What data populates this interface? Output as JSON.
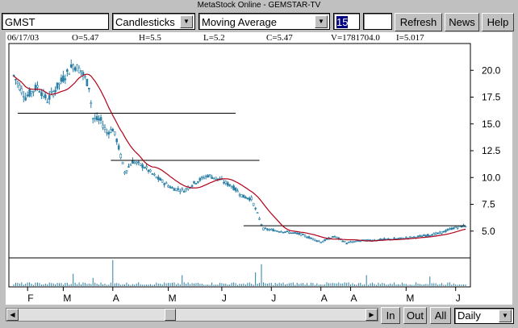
{
  "window": {
    "title": "MetaStock Online - GEMSTAR-TV"
  },
  "toolbar": {
    "symbol": "GMST",
    "chart_style": "Candlesticks",
    "indicator": "Moving Average",
    "period": "15",
    "extra": "",
    "refresh_label": "Refresh",
    "news_label": "News",
    "help_label": "Help"
  },
  "info": {
    "date": "06/17/03",
    "open": "O=5.47",
    "high": "H=5.5",
    "low": "L=5.2",
    "close": "C=5.47",
    "volume": "V=1781704.0",
    "indicator": "I=5.017"
  },
  "bottom": {
    "in_label": "In",
    "out_label": "Out",
    "all_label": "All",
    "period_select": "Daily"
  },
  "chart_data": {
    "type": "candlestick",
    "title": "",
    "y_ticks": [
      "20.0",
      "17.5",
      "15.0",
      "12.5",
      "10.0",
      "7.5",
      "5.0"
    ],
    "ylim": [
      2.5,
      22.5
    ],
    "x_ticks": [
      "F",
      "M",
      "A",
      "M",
      "J",
      "J",
      "A",
      "A",
      "M",
      "J"
    ],
    "price_anchors": [
      [
        0,
        19.5
      ],
      [
        6,
        17.5
      ],
      [
        12,
        18.5
      ],
      [
        17,
        17.2
      ],
      [
        24,
        19.0
      ],
      [
        30,
        20.5
      ],
      [
        34,
        20.0
      ],
      [
        38,
        18.5
      ],
      [
        40,
        15.5
      ],
      [
        44,
        15.3
      ],
      [
        47,
        14.2
      ],
      [
        50,
        14.5
      ],
      [
        52,
        13.5
      ],
      [
        56,
        10.5
      ],
      [
        60,
        11.5
      ],
      [
        66,
        11.0
      ],
      [
        72,
        10.0
      ],
      [
        80,
        9.0
      ],
      [
        86,
        8.8
      ],
      [
        92,
        9.6
      ],
      [
        98,
        10.2
      ],
      [
        104,
        9.8
      ],
      [
        110,
        9.2
      ],
      [
        116,
        8.2
      ],
      [
        120,
        8.0
      ],
      [
        126,
        5.2
      ],
      [
        135,
        5.0
      ],
      [
        145,
        4.7
      ],
      [
        155,
        4.0
      ],
      [
        162,
        4.5
      ],
      [
        168,
        3.9
      ],
      [
        175,
        4.1
      ],
      [
        185,
        4.2
      ],
      [
        195,
        4.3
      ],
      [
        205,
        4.5
      ],
      [
        215,
        4.8
      ],
      [
        222,
        5.3
      ],
      [
        228,
        5.5
      ]
    ],
    "moving_average": {
      "name": "I",
      "period": 15
    },
    "trend_lines": [
      {
        "from": [
          2,
          16.0
        ],
        "to": [
          112,
          16.0
        ]
      },
      {
        "from": [
          49,
          11.6
        ],
        "to": [
          124,
          11.6
        ]
      },
      {
        "from": [
          116,
          5.5
        ],
        "to": [
          228,
          5.5
        ]
      }
    ],
    "volume_spikes": [
      [
        50,
        0.95
      ],
      [
        125,
        0.8
      ],
      [
        122,
        0.5
      ],
      [
        30,
        0.45
      ],
      [
        85,
        0.4
      ],
      [
        178,
        0.4
      ],
      [
        210,
        0.35
      ],
      [
        40,
        0.3
      ]
    ]
  }
}
